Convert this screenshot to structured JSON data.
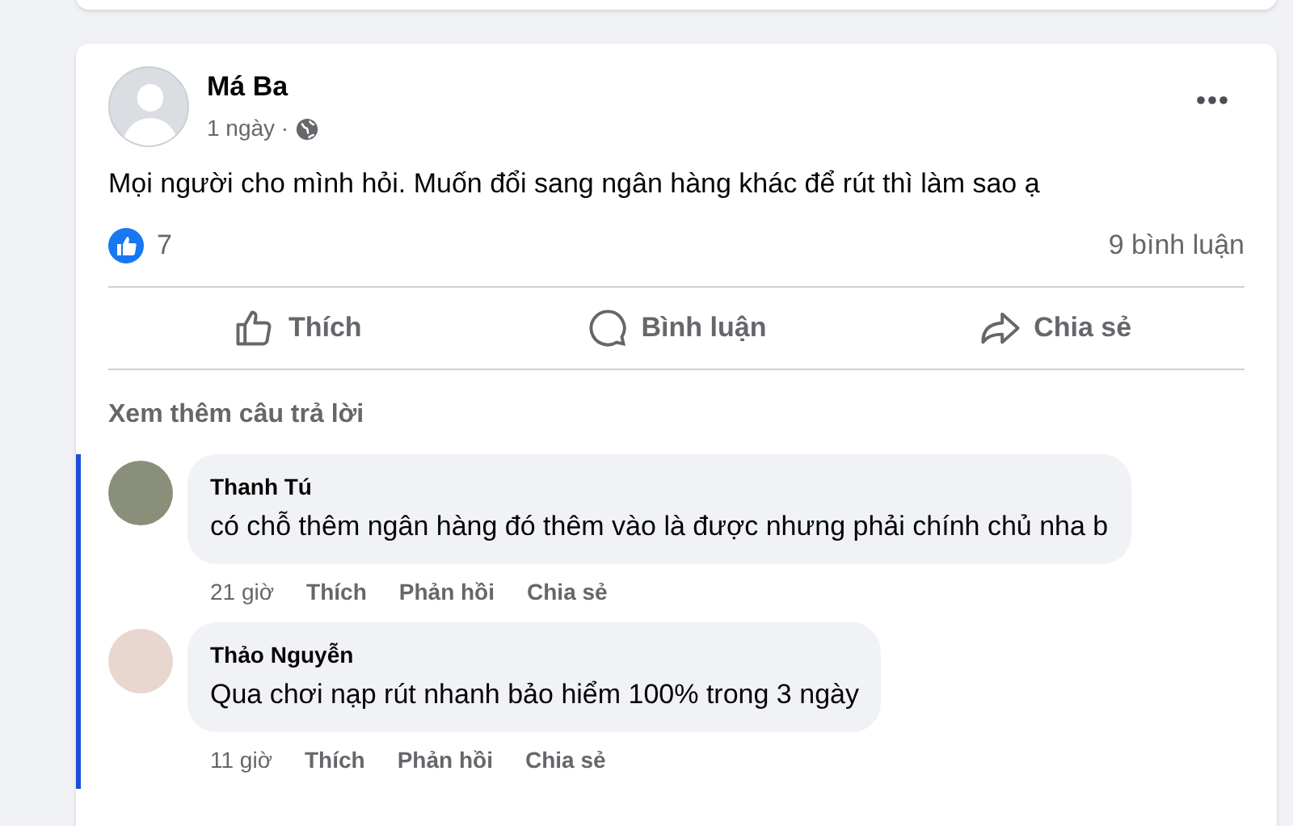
{
  "post": {
    "author": "Má Ba",
    "time": "1 ngày ·",
    "text": "Mọi người cho mình hỏi. Muốn đổi sang ngân hàng khác để rút thì làm sao ạ",
    "likes": "7",
    "comment_count": "9 bình luận"
  },
  "actions": [
    {
      "kind": "like",
      "label": "Thích"
    },
    {
      "kind": "comment",
      "label": "Bình luận"
    },
    {
      "kind": "share",
      "label": "Chia sẻ"
    }
  ],
  "more_replies": "Xem thêm câu trả lời",
  "comments": [
    {
      "author": "Thanh Tú",
      "text": "có chỗ thêm ngân hàng đó thêm vào là được nhưng phải chính chủ nha b",
      "time": "21 giờ",
      "actions": [
        "Thích",
        "Phản hồi",
        "Chia sẻ"
      ]
    },
    {
      "author": "Thảo Nguyễn",
      "text": "Qua chơi nạp rút nhanh bảo hiểm 100% trong 3 ngày",
      "time": "11 giờ",
      "actions": [
        "Thích",
        "Phản hồi",
        "Chia sẻ"
      ]
    }
  ]
}
